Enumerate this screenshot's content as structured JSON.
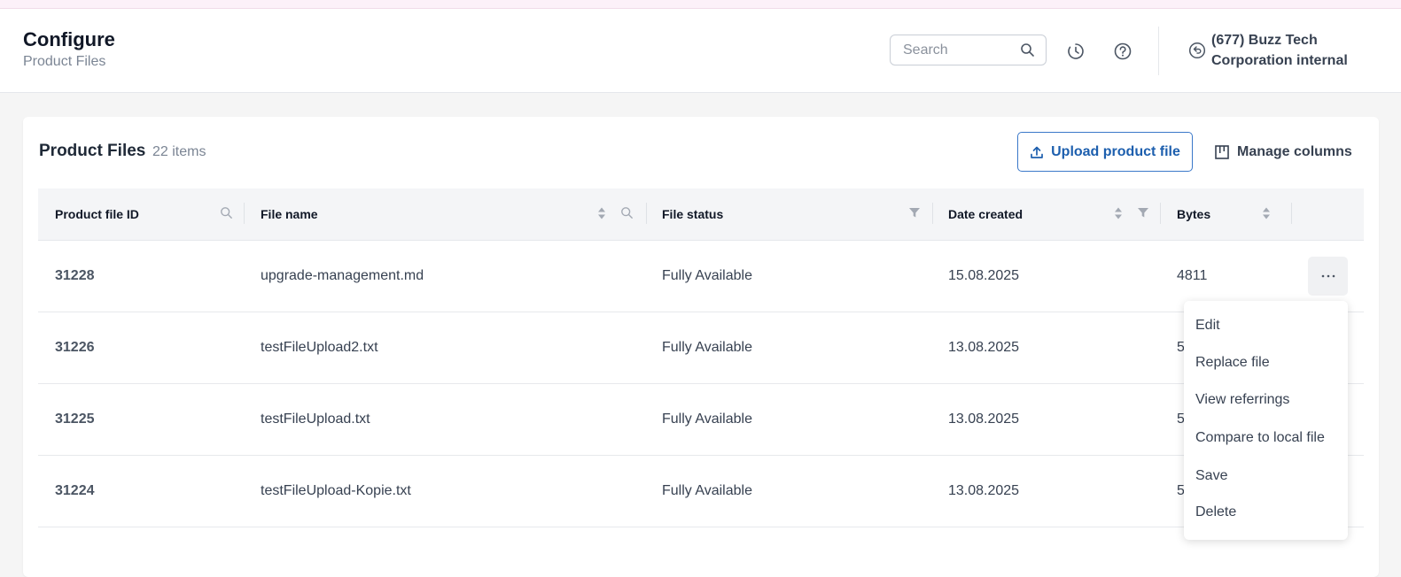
{
  "header": {
    "title": "Configure",
    "subtitle": "Product Files",
    "search_placeholder": "Search",
    "tenant_name": "(677) Buzz Tech Corporation internal",
    "icons": [
      "search-icon",
      "history-icon",
      "help-icon",
      "switch-tenant-icon"
    ]
  },
  "card": {
    "title": "Product Files",
    "count": "22 items",
    "upload_label": "Upload product file",
    "manage_label": "Manage columns"
  },
  "table": {
    "columns": [
      "Product file ID",
      "File name",
      "File status",
      "Date created",
      "Bytes"
    ],
    "rows": [
      {
        "id": "31228",
        "name": "upgrade-management.md",
        "status": "Fully Available",
        "date": "15.08.2025",
        "bytes": "4811"
      },
      {
        "id": "31226",
        "name": "testFileUpload2.txt",
        "status": "Fully Available",
        "date": "13.08.2025",
        "bytes": "5"
      },
      {
        "id": "31225",
        "name": "testFileUpload.txt",
        "status": "Fully Available",
        "date": "13.08.2025",
        "bytes": "5"
      },
      {
        "id": "31224",
        "name": "testFileUpload-Kopie.txt",
        "status": "Fully Available",
        "date": "13.08.2025",
        "bytes": "5"
      }
    ]
  },
  "row_menu": {
    "items": [
      "Edit",
      "Replace file",
      "View referrings",
      "Compare to local file",
      "Save",
      "Delete"
    ]
  },
  "colors": {
    "accent": "#1d5fae",
    "top_strip": "#fcf1f9",
    "header_bg": "#f4f5f7"
  }
}
